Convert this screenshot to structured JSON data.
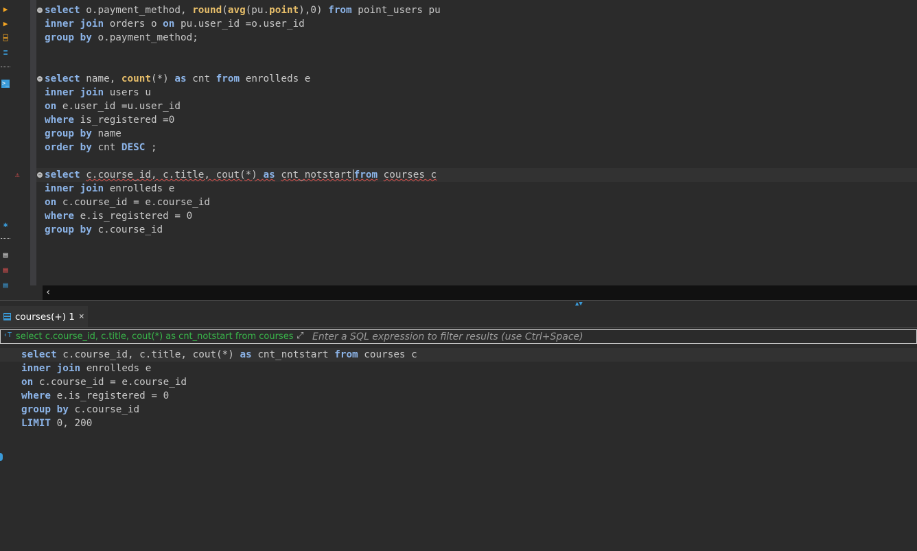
{
  "editor": {
    "lines": [
      {
        "segments": [
          [
            "kw",
            "select"
          ],
          [
            "",
            "o.payment_method, "
          ],
          [
            "fn",
            "round"
          ],
          [
            "",
            "("
          ],
          [
            "fn",
            "avg"
          ],
          [
            "",
            "(pu."
          ],
          [
            "fn",
            "point"
          ],
          [
            "",
            "),0) "
          ],
          [
            "kw",
            "from"
          ],
          [
            "",
            "point_users pu"
          ]
        ],
        "fold": true
      },
      {
        "segments": [
          [
            "kw",
            "inner join"
          ],
          [
            "",
            "orders o "
          ],
          [
            "kw",
            "on"
          ],
          [
            "",
            "pu.user_id =o.user_id"
          ]
        ]
      },
      {
        "segments": [
          [
            "kw",
            "group by"
          ],
          [
            "",
            "o.payment_method;"
          ]
        ]
      },
      {
        "segments": []
      },
      {
        "segments": []
      },
      {
        "segments": [
          [
            "kw",
            "select"
          ],
          [
            "",
            "name, "
          ],
          [
            "fn",
            "count"
          ],
          [
            "",
            "(*) "
          ],
          [
            "kw",
            "as"
          ],
          [
            "",
            "cnt "
          ],
          [
            "kw",
            "from"
          ],
          [
            "",
            "enrolleds e"
          ]
        ],
        "fold": true
      },
      {
        "segments": [
          [
            "kw",
            "inner join"
          ],
          [
            "",
            "users u"
          ]
        ]
      },
      {
        "segments": [
          [
            "kw",
            "on"
          ],
          [
            "",
            "e.user_id =u.user_id"
          ]
        ]
      },
      {
        "segments": [
          [
            "kw",
            "where"
          ],
          [
            "",
            "is_registered =0"
          ]
        ]
      },
      {
        "segments": [
          [
            "kw",
            "group by"
          ],
          [
            "",
            "name"
          ]
        ]
      },
      {
        "segments": [
          [
            "kw",
            "order by"
          ],
          [
            "",
            "cnt "
          ],
          [
            "kw",
            "DESC"
          ],
          [
            "",
            ";"
          ]
        ]
      },
      {
        "segments": []
      },
      {
        "segments": [
          [
            "kw",
            "select"
          ],
          [
            "sq",
            "c.course_id, c.title, cout(*) "
          ],
          [
            "kwsq",
            "as"
          ],
          [
            "sq",
            "cnt_notstart"
          ],
          [
            "caret",
            ""
          ],
          [
            "kwsq",
            "from"
          ],
          [
            "sq",
            "courses c"
          ]
        ],
        "fold": true,
        "current": true,
        "warning": true
      },
      {
        "segments": [
          [
            "kw",
            "inner join"
          ],
          [
            "",
            "enrolleds e"
          ]
        ]
      },
      {
        "segments": [
          [
            "kw",
            "on"
          ],
          [
            "",
            "c.course_id = e.course_id"
          ]
        ]
      },
      {
        "segments": [
          [
            "kw",
            "where"
          ],
          [
            "",
            "e.is_registered = 0"
          ]
        ]
      },
      {
        "segments": [
          [
            "kw",
            "group by"
          ],
          [
            "",
            "c.course_id"
          ]
        ]
      }
    ]
  },
  "results_tab": {
    "label": "courses(+) 1",
    "close": "×"
  },
  "filter": {
    "history": "select c.course_id, c.title, cout(*) as cnt_notstart from courses c",
    "placeholder": "Enter a SQL expression to filter results (use Ctrl+Space)"
  },
  "query_text": {
    "lines": [
      {
        "segments": [
          [
            "kw",
            "select"
          ],
          [
            "",
            "c.course_id, c.title, cout(*) "
          ],
          [
            "kw",
            "as"
          ],
          [
            "",
            "cnt_notstart "
          ],
          [
            "kw",
            "from"
          ],
          [
            "",
            "courses c"
          ]
        ]
      },
      {
        "segments": [
          [
            "kw",
            "inner join"
          ],
          [
            "",
            "enrolleds e"
          ]
        ]
      },
      {
        "segments": [
          [
            "kw",
            "on"
          ],
          [
            "",
            "c.course_id = e.course_id"
          ]
        ]
      },
      {
        "segments": [
          [
            "kw",
            "where"
          ],
          [
            "",
            "e.is_registered = 0"
          ]
        ]
      },
      {
        "segments": [
          [
            "kw",
            "group by"
          ],
          [
            "",
            "c.course_id"
          ]
        ]
      },
      {
        "segments": [
          [
            "kw",
            "LIMIT"
          ],
          [
            "",
            "0, 200"
          ]
        ]
      }
    ]
  },
  "icons": {
    "toolbar": [
      "execute-statement-icon",
      "execute-script-icon",
      "explain-plan-icon",
      "load-plan-icon",
      "console-icon",
      "settings-icon",
      "save-file-icon",
      "error-file-icon",
      "export-file-icon"
    ],
    "warning": "⚠",
    "scroll_left": "‹",
    "fold_marker": "⊖"
  },
  "colors": {
    "keyword": "#8cb4e8",
    "function": "#e8bf6a",
    "background": "#2b2b2b",
    "accent": "#3a9bd9",
    "history": "#39b54a"
  }
}
